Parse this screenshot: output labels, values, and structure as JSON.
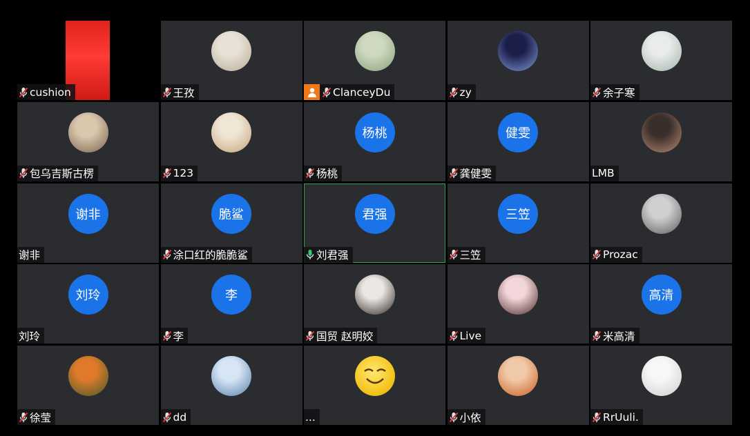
{
  "tiles": [
    {
      "name": "cushion",
      "mic": "muted",
      "kind": "video"
    },
    {
      "name": "王孜",
      "mic": "muted",
      "kind": "photo",
      "colors": [
        "#e8e2d6",
        "#b9ab98"
      ]
    },
    {
      "name": "ClanceyDu",
      "mic": "muted",
      "kind": "photo",
      "badge": "person-icon",
      "colors": [
        "#cfd9c2",
        "#8aa17a"
      ]
    },
    {
      "name": "zy",
      "mic": "muted",
      "kind": "photo",
      "colors": [
        "#1c1e4a",
        "#7f9ad6"
      ]
    },
    {
      "name": "余子寒",
      "mic": "muted",
      "kind": "photo",
      "colors": [
        "#e9ece8",
        "#a3b3ad"
      ]
    },
    {
      "name": "包乌吉斯古楞",
      "mic": "muted",
      "kind": "photo",
      "colors": [
        "#d9c8ad",
        "#7a6150"
      ]
    },
    {
      "name": "123",
      "mic": "muted",
      "kind": "photo",
      "colors": [
        "#f0e6d5",
        "#c5a27a"
      ]
    },
    {
      "name": "杨桃",
      "mic": "muted",
      "kind": "text",
      "avatar_text": "杨桃"
    },
    {
      "name": "龚健雯",
      "mic": "muted",
      "kind": "text",
      "avatar_text": "健雯"
    },
    {
      "name": "LMB",
      "mic": "none",
      "kind": "photo",
      "colors": [
        "#3a2e2a",
        "#b88a73"
      ]
    },
    {
      "name": "谢非",
      "mic": "none",
      "kind": "text",
      "avatar_text": "谢非"
    },
    {
      "name": "涂口红的脆脆鲨",
      "mic": "muted",
      "kind": "text",
      "avatar_text": "脆鲨"
    },
    {
      "name": "刘君强",
      "mic": "active",
      "kind": "text",
      "avatar_text": "君强",
      "speaking": true
    },
    {
      "name": "三笠",
      "mic": "muted",
      "kind": "text",
      "avatar_text": "三笠"
    },
    {
      "name": "Prozac",
      "mic": "muted",
      "kind": "photo",
      "colors": [
        "#d0d0d0",
        "#5c5c5c"
      ]
    },
    {
      "name": "刘玲",
      "mic": "none",
      "kind": "text",
      "avatar_text": "刘玲"
    },
    {
      "name": "李",
      "mic": "muted",
      "kind": "text",
      "avatar_text": "李"
    },
    {
      "name": "国贸 赵明姣",
      "mic": "muted",
      "kind": "photo",
      "colors": [
        "#ece7e2",
        "#2c2826"
      ]
    },
    {
      "name": "Live",
      "mic": "muted",
      "kind": "photo",
      "colors": [
        "#f3d6d9",
        "#4b2c2a"
      ]
    },
    {
      "name": "米高清",
      "mic": "muted",
      "kind": "text",
      "avatar_text": "高清"
    },
    {
      "name": "徐莹",
      "mic": "muted",
      "kind": "photo",
      "colors": [
        "#e07a2a",
        "#3f5a2c"
      ]
    },
    {
      "name": "dd",
      "mic": "muted",
      "kind": "photo",
      "colors": [
        "#d7e6f6",
        "#5a7fa8"
      ]
    },
    {
      "name": "...",
      "mic": "none",
      "kind": "emoji"
    },
    {
      "name": "小依",
      "mic": "muted",
      "kind": "photo",
      "colors": [
        "#f0c9a8",
        "#c85d1e"
      ]
    },
    {
      "name": "RrUuli.",
      "mic": "muted",
      "kind": "photo",
      "colors": [
        "#f7f7f7",
        "#cfcfcf"
      ]
    }
  ],
  "colors": {
    "tile_bg": "#2b2c30",
    "avatar_blue": "#1a73e8",
    "speaking_border": "#29a35a",
    "badge_orange": "#f07a1a"
  }
}
